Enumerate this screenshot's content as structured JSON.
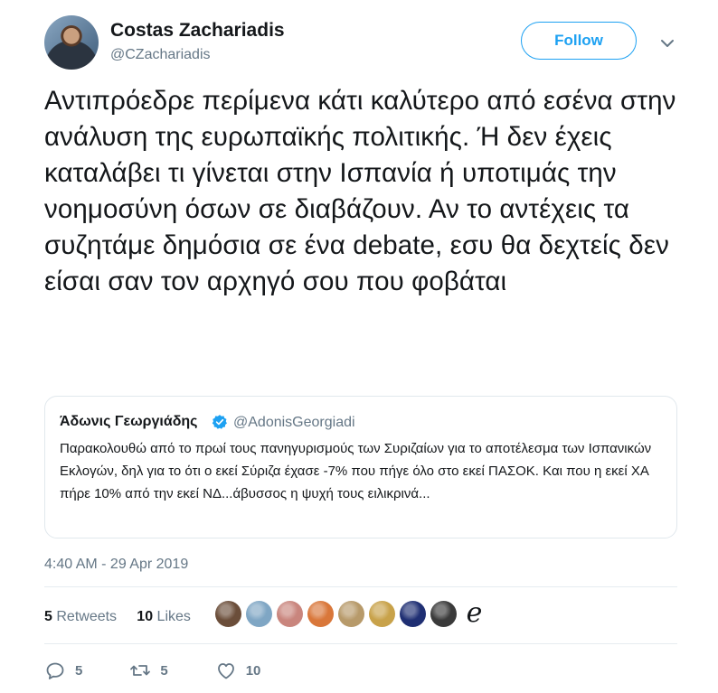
{
  "author": {
    "name": "Costas Zachariadis",
    "handle": "@CZachariadis",
    "follow_label": "Follow"
  },
  "tweet": {
    "text": "Αντιπρόεδρε περίμενα κάτι καλύτερο από εσένα στην ανάλυση της ευρωπαϊκής πολιτικής. Ή δεν έχεις καταλάβει τι γίνεται στην Ισπανία ή υποτιμάς την νοημοσύνη όσων σε διαβάζουν. Αν το αντέχεις τα συζητάμε δημόσια σε ένα debate, εσυ θα δεχτείς δεν είσαι σαν τον αρχηγό σου που φοβάται"
  },
  "quoted": {
    "name": "Άδωνις Γεωργιάδης",
    "handle": "@AdonisGeorgiadi",
    "text": "Παρακολουθώ από το πρωί τους πανηγυρισμούς των Συριζαίων για το αποτέλεσμα των Ισπανικών Εκλογών, δηλ για το ότι ο εκεί Σύριζα έχασε -7% που πήγε όλο στο εκεί ΠΑΣΟΚ. Και που η εκεί ΧΑ πήρε 10% από την εκεί ΝΔ...άβυσσος η ψυχή τους ειλικρινά..."
  },
  "timestamp": "4:40 AM - 29 Apr 2019",
  "stats": {
    "retweets_count": "5",
    "retweets_label": "Retweets",
    "likes_count": "10",
    "likes_label": "Likes"
  },
  "likers": [
    "#6b4e3a",
    "#7fa6c4",
    "#c9857d",
    "#d9773a",
    "#b79a6a",
    "#c8a24a",
    "#1f2f73",
    "#3a3a3a"
  ],
  "liker_last_glyph": "e",
  "actions": {
    "reply_count": "5",
    "retweet_count": "5",
    "like_count": "10"
  },
  "colors": {
    "accent": "#1da1f2",
    "secondary_text": "#657786",
    "border": "#e1e8ed"
  }
}
